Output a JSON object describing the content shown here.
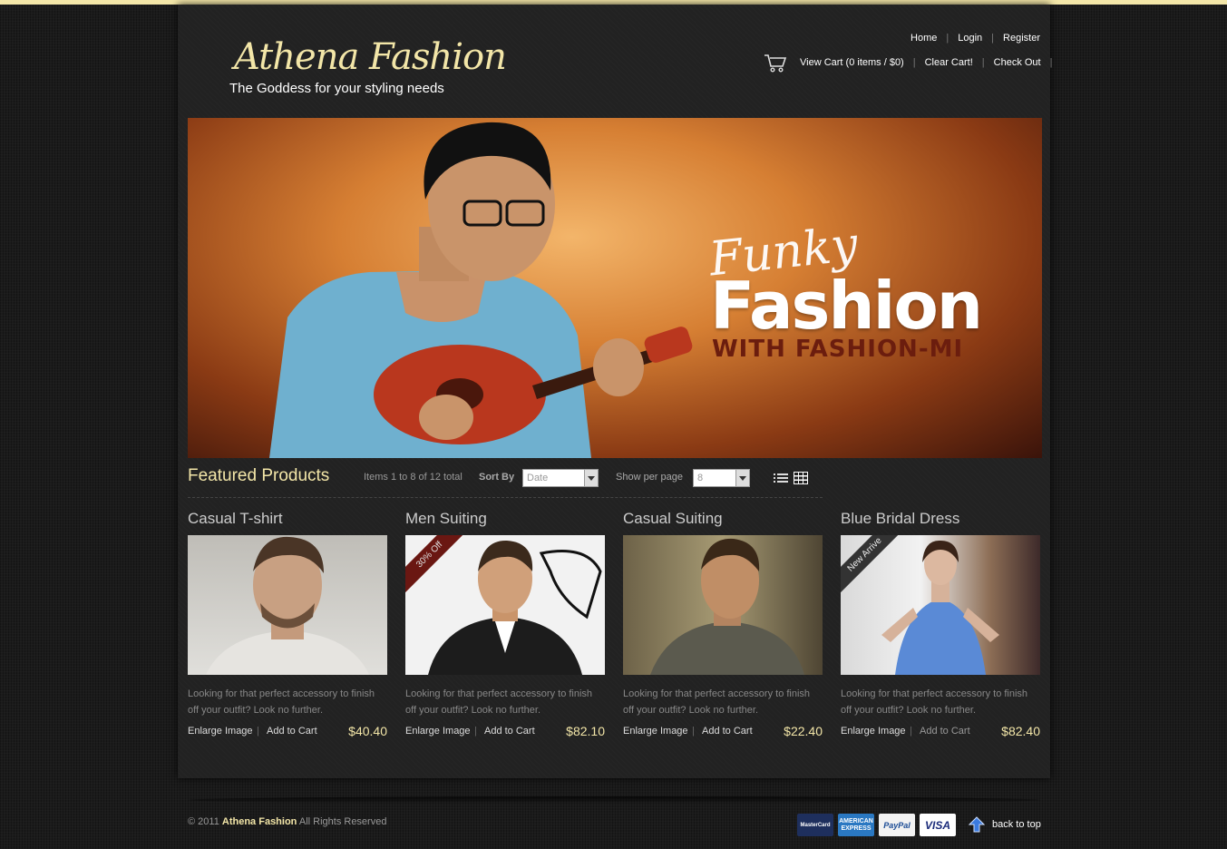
{
  "brand": {
    "logo": "Athena Fashion",
    "tagline": "The Goddess for your styling needs"
  },
  "topnav": {
    "home": "Home",
    "login": "Login",
    "register": "Register"
  },
  "cartnav": {
    "view_cart": "View Cart (0 items / $0)",
    "clear_cart": "Clear Cart!",
    "checkout": "Check Out"
  },
  "hero": {
    "line1": "Funky",
    "line2": "Fashion",
    "line3": "WITH FASHION-MI"
  },
  "featured": {
    "title": "Featured Products",
    "items_info": "Items 1 to 8 of 12 total",
    "sort_label": "Sort By",
    "sort_value": "Date",
    "perpage_label": "Show per page",
    "perpage_value": "8"
  },
  "products": [
    {
      "name": "Casual T-shirt",
      "desc": "Looking for that perfect accessory to finish off your outfit? Look no further.",
      "enlarge": "Enlarge Image",
      "add": "Add to Cart",
      "price": "$40.40",
      "ribbon": ""
    },
    {
      "name": "Men Suiting",
      "desc": "Looking for that perfect accessory to finish off your outfit? Look no further.",
      "enlarge": "Enlarge Image",
      "add": "Add to Cart",
      "price": "$82.10",
      "ribbon": "30% Off"
    },
    {
      "name": "Casual Suiting",
      "desc": "Looking for that perfect accessory to finish off your outfit? Look no further.",
      "enlarge": "Enlarge Image",
      "add": "Add to Cart",
      "price": "$22.40",
      "ribbon": ""
    },
    {
      "name": "Blue Bridal Dress",
      "desc": "Looking for that perfect accessory to finish off your outfit? Look no further.",
      "enlarge": "Enlarge Image",
      "add": "Add to Cart",
      "price": "$82.40",
      "ribbon": "New Arrive"
    }
  ],
  "footer": {
    "copyright_prefix": "© 2011",
    "brand": "Athena Fashion",
    "copyright_suffix": "All Rights Reserved",
    "payments": [
      "MasterCard",
      "AMERICAN EXPRESS",
      "PayPal",
      "VISA"
    ],
    "back_to_top": "back to top"
  },
  "colors": {
    "accent": "#f3e6a8",
    "background": "#1b1b1b",
    "panel": "#222222",
    "ribbon_sale": "#6a1712"
  }
}
